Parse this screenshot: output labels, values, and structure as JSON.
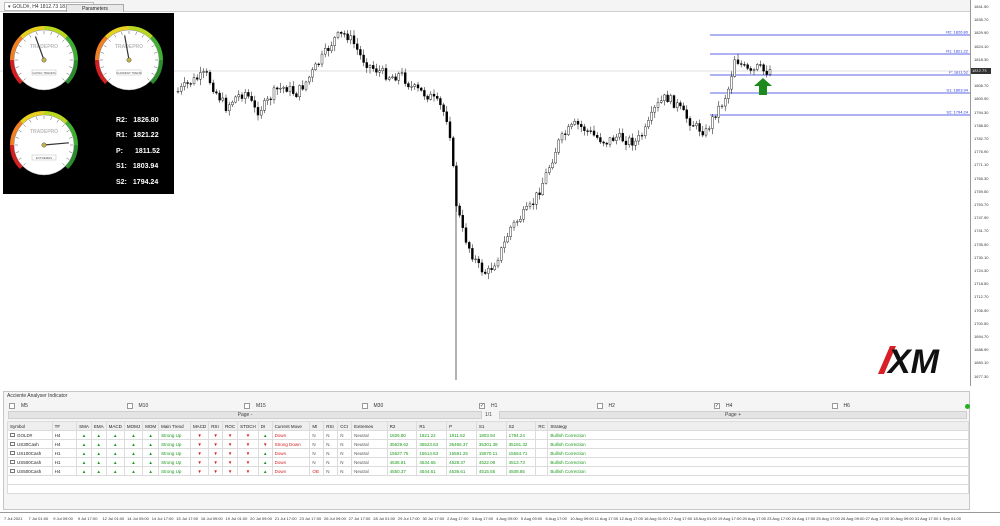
{
  "title_bar": {
    "text": "GOLD#, H4  1812.73 1814.61 1812",
    "params_tab": "Parameters"
  },
  "price_axis": {
    "labels": [
      "1841.50",
      "1835.70",
      "1829.90",
      "1824.10",
      "1818.30",
      "1812.50",
      "1806.70",
      "1800.90",
      "1794.30",
      "1788.50",
      "1782.70",
      "1776.90",
      "1771.10",
      "1765.30",
      "1759.50",
      "1753.70",
      "1747.90",
      "1741.70",
      "1735.90",
      "1730.10",
      "1724.30",
      "1718.50",
      "1712.70",
      "1706.90",
      "1700.50",
      "1694.70",
      "1688.90",
      "1683.10",
      "1677.30"
    ],
    "current_price": "1812.73"
  },
  "pivot_lines": [
    {
      "label": "R2: 1826.80",
      "color": "#2233dd"
    },
    {
      "label": "R1: 1821.22",
      "color": "#2233dd"
    },
    {
      "label": "P: 1811.52",
      "color": "#2233dd"
    },
    {
      "label": "S1: 1803.94",
      "color": "#2233dd"
    },
    {
      "label": "S2: 1794.24",
      "color": "#2233dd"
    }
  ],
  "gauges": [
    {
      "brand": "TRADEPRO",
      "caption": "GOING TRENDS",
      "needle_deg": -20
    },
    {
      "brand": "TRADEPRO",
      "caption": "CURRENT TREND",
      "needle_deg": -10
    },
    {
      "brand": "TRADEPRO",
      "caption": "EXTREMES",
      "needle_deg": 85
    }
  ],
  "levels": [
    {
      "name": "R2:",
      "value": "1826.80"
    },
    {
      "name": "R1:",
      "value": "1821.22"
    },
    {
      "name": "P:",
      "value": "1811.52"
    },
    {
      "name": "S1:",
      "value": "1803.94"
    },
    {
      "name": "S2:",
      "value": "1794.24"
    }
  ],
  "logo": "XM",
  "panel": {
    "title": "Acciente Analyser Indicator",
    "timeframes": [
      {
        "label": "M5",
        "checked": false
      },
      {
        "label": "M10",
        "checked": false
      },
      {
        "label": "M15",
        "checked": false
      },
      {
        "label": "M30",
        "checked": false
      },
      {
        "label": "H1",
        "checked": true
      },
      {
        "label": "H2",
        "checked": false
      },
      {
        "label": "H4",
        "checked": true
      },
      {
        "label": "H6",
        "checked": false
      }
    ],
    "page_minus": "Page -",
    "page_plus": "Page +",
    "page_indicator": "1/1",
    "columns": [
      "Symbol",
      "TF",
      "SMA",
      "EMA",
      "MACD",
      "MOMJ",
      "MOM",
      "Main Trend",
      "MACD",
      "RSI",
      "ROC",
      "STOCH",
      "DI",
      "Current Move",
      "MI",
      "RSI",
      "CCI",
      "Extremes",
      "R2",
      "R1",
      "P",
      "S1",
      "S2",
      "RC",
      "Strategy"
    ],
    "rows": [
      {
        "symbol": "GOLD#",
        "tf": "H4",
        "arrows1": [
          "up",
          "up",
          "up",
          "up",
          "up"
        ],
        "main_trend": "Strong Up",
        "arrows2": [
          "down",
          "down",
          "down",
          "down",
          "up"
        ],
        "current_move": "Down",
        "mi": "N",
        "rsi": "N",
        "cci": "N",
        "extremes": "Neutral",
        "r2": "1826.80",
        "r1": "1821.22",
        "p": "1811.52",
        "s1": "1803.94",
        "s2": "1794.24",
        "rc": "",
        "strategy": "Bullish Correction"
      },
      {
        "symbol": "US30Cash",
        "tf": "H4",
        "arrows1": [
          "up",
          "up",
          "up",
          "up",
          "up"
        ],
        "main_trend": "Strong Up",
        "arrows2": [
          "down",
          "down",
          "down",
          "down",
          "down"
        ],
        "current_move": "Strong Down",
        "mi": "N",
        "rsi": "N",
        "cci": "N",
        "extremes": "Neutral",
        "r2": "35629.62",
        "r1": "35523.63",
        "p": "35465.37",
        "s1": "35301.38",
        "s2": "35181.32",
        "rc": "",
        "strategy": "Bullish Correction"
      },
      {
        "symbol": "US100Cash",
        "tf": "H1",
        "arrows1": [
          "up",
          "up",
          "up",
          "up",
          "up"
        ],
        "main_trend": "Strong Up",
        "arrows2": [
          "down",
          "down",
          "down",
          "down",
          "up"
        ],
        "current_move": "Down",
        "mi": "N",
        "rsi": "N",
        "cci": "N",
        "extremes": "Neutral",
        "r2": "15627.75",
        "r1": "15614.63",
        "p": "15591.25",
        "s1": "15570.11",
        "s2": "15554.71",
        "rc": "",
        "strategy": "Bullish Correction"
      },
      {
        "symbol": "US500Cash",
        "tf": "H1",
        "arrows1": [
          "up",
          "up",
          "up",
          "up",
          "up"
        ],
        "main_trend": "Strong Up",
        "arrows2": [
          "down",
          "down",
          "down",
          "down",
          "up"
        ],
        "current_move": "Down",
        "mi": "N",
        "rsi": "N",
        "cci": "N",
        "extremes": "Neutral",
        "r2": "4536.81",
        "r1": "4534.65",
        "p": "4528.37",
        "s1": "4522.08",
        "s2": "4513.73",
        "rc": "",
        "strategy": "Bullish Correction"
      },
      {
        "symbol": "US500Cash",
        "tf": "H4",
        "arrows1": [
          "up",
          "up",
          "up",
          "up",
          "up"
        ],
        "main_trend": "Strong Up",
        "arrows2": [
          "down",
          "down",
          "down",
          "down",
          "up"
        ],
        "current_move": "Down",
        "mi": "OB",
        "rsi": "N",
        "cci": "N",
        "extremes": "Neutral",
        "r2": "4550.37",
        "r1": "4544.61",
        "p": "4536.61",
        "s1": "4515.55",
        "s2": "4508.85",
        "rc": "",
        "strategy": "Bullish Correction"
      }
    ]
  },
  "time_axis": [
    "7 Jul 2021",
    "7 Jul 01:00",
    "9 Jul 09:00",
    "9 Jul 17:00",
    "12 Jul 01:00",
    "14 Jul 09:00",
    "14 Jul 17:00",
    "15 Jul 17:00",
    "16 Jul 09:00",
    "19 Jul 01:00",
    "20 Jul 09:00",
    "21 Jul 17:00",
    "23 Jul 17:00",
    "26 Jul 09:00",
    "27 Jul 17:00",
    "28 Jul 01:00",
    "29 Jul 17:00",
    "30 Jul 17:00",
    "2 Aug 17:00",
    "3 Aug 17:00",
    "4 Aug 09:00",
    "5 Aug 09:00",
    "6 Aug 17:00",
    "10 Aug 09:00",
    "11 Aug 17:00",
    "12 Aug 17:00",
    "16 Aug 01:00",
    "17 Aug 17:00",
    "18 Aug 01:00",
    "19 Aug 17:00",
    "20 Aug 17:00",
    "23 Aug 17:00",
    "24 Aug 17:00",
    "25 Aug 17:00",
    "26 Aug 09:00",
    "27 Aug 17:00",
    "30 Aug 09:00",
    "31 Aug 17:00",
    "1 Sep 01:00"
  ]
}
